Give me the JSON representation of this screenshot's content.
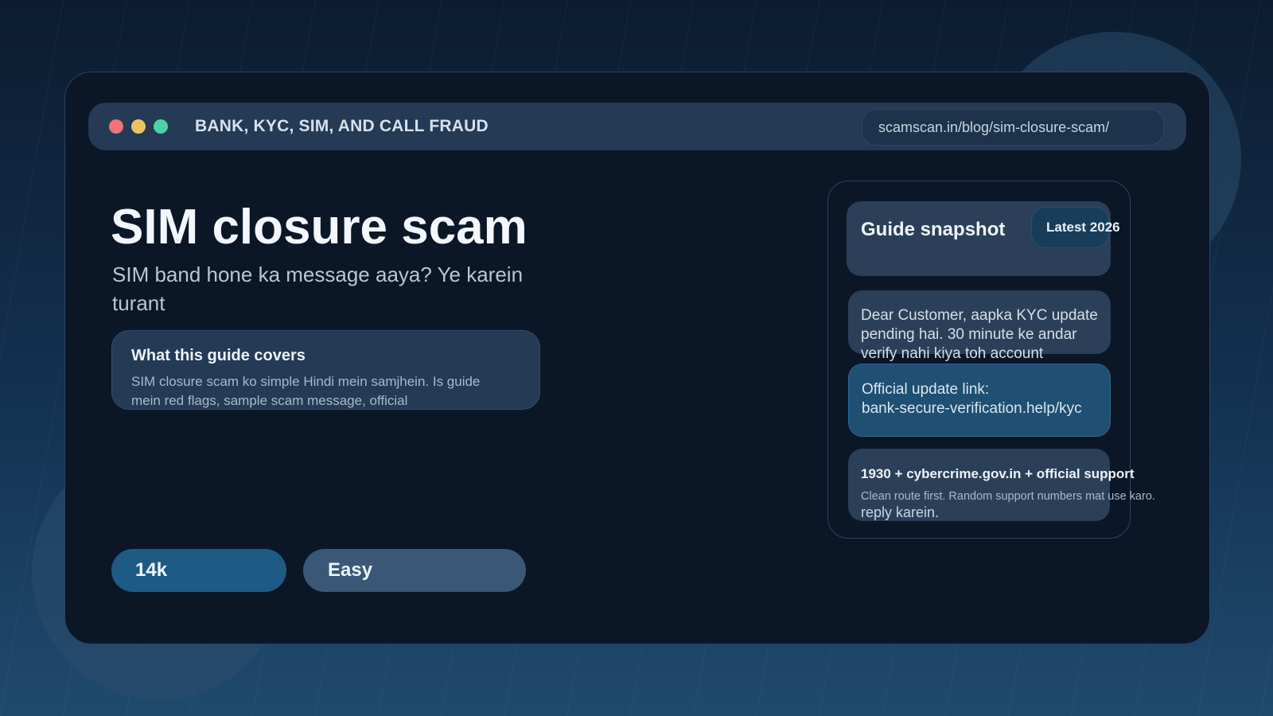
{
  "window": {
    "title": "BANK, KYC, SIM, AND CALL FRAUD",
    "url": "scamscan.in/blog/sim-closure-scam/",
    "controls": {
      "close_color": "#ef7377",
      "minimize_color": "#eec263",
      "maximize_color": "#4fd1a5"
    }
  },
  "hero": {
    "title": "SIM closure scam",
    "subtitle": "SIM band hone ka message aaya? Ye karein turant"
  },
  "covers": {
    "heading": "What this guide covers",
    "body": "SIM closure scam ko simple Hindi mein samjhein. Is guide mein red flags, sample scam message, official"
  },
  "stats": {
    "views": "14k",
    "level": "Easy"
  },
  "snapshot": {
    "title": "Guide snapshot",
    "badge": "Latest 2026",
    "message": "Dear Customer, aapka KYC update pending hai. 30 minute ke andar verify nahi kiya toh account",
    "link_label": "Official update link:",
    "link_url": "bank-secure-verification.help/kyc",
    "support_title": "1930 + cybercrime.gov.in + official support",
    "support_body": "Clean route first. Random support numbers mat use karo.",
    "support_tail": "reply karein."
  },
  "colors": {
    "accent": "#1e5b84",
    "card": "#243a55",
    "frame": "#0b1627"
  }
}
